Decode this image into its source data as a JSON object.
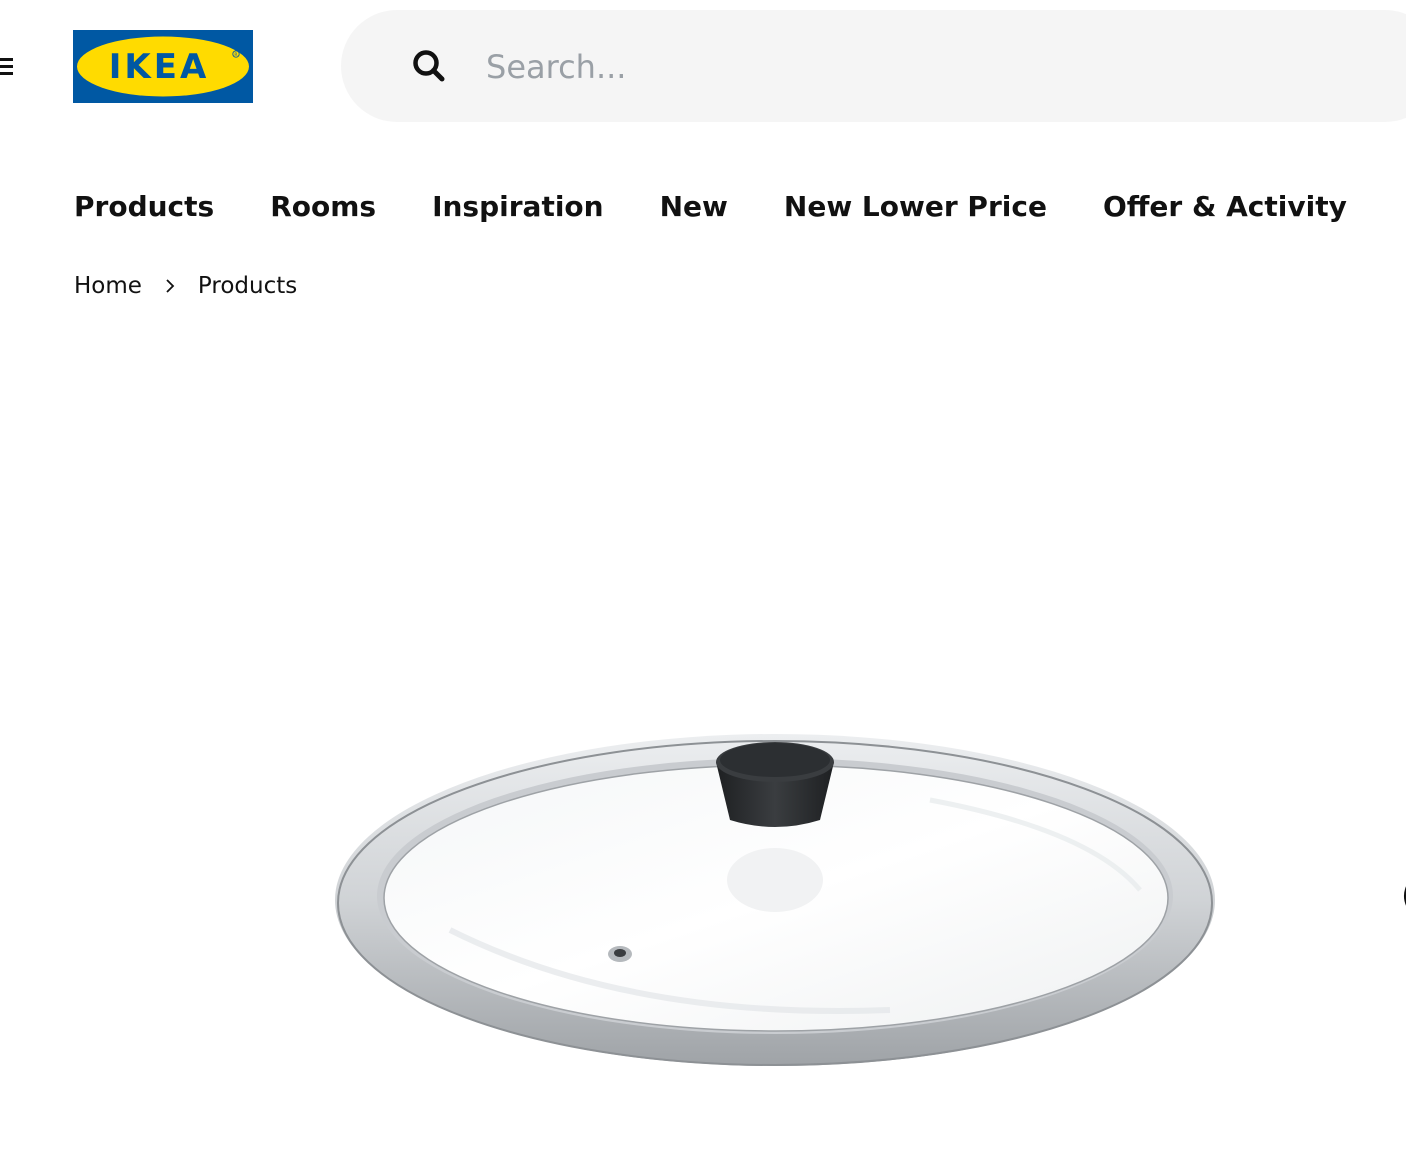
{
  "header": {
    "logo_text": "IKEA",
    "logo_colors": {
      "background": "#0058a3",
      "oval": "#ffdb00",
      "text": "#0058a3"
    },
    "search": {
      "placeholder": "Search...",
      "value": ""
    }
  },
  "nav": {
    "items": [
      {
        "label": "Products"
      },
      {
        "label": "Rooms"
      },
      {
        "label": "Inspiration"
      },
      {
        "label": "New"
      },
      {
        "label": "New Lower Price"
      },
      {
        "label": "Offer & Activity"
      }
    ]
  },
  "breadcrumb": {
    "items": [
      {
        "label": "Home"
      },
      {
        "label": "Products"
      }
    ]
  },
  "product": {
    "image_subject": "glass-pan-lid",
    "knob_color": "#2a2c2f",
    "rim_color": "#b9bcbf"
  }
}
